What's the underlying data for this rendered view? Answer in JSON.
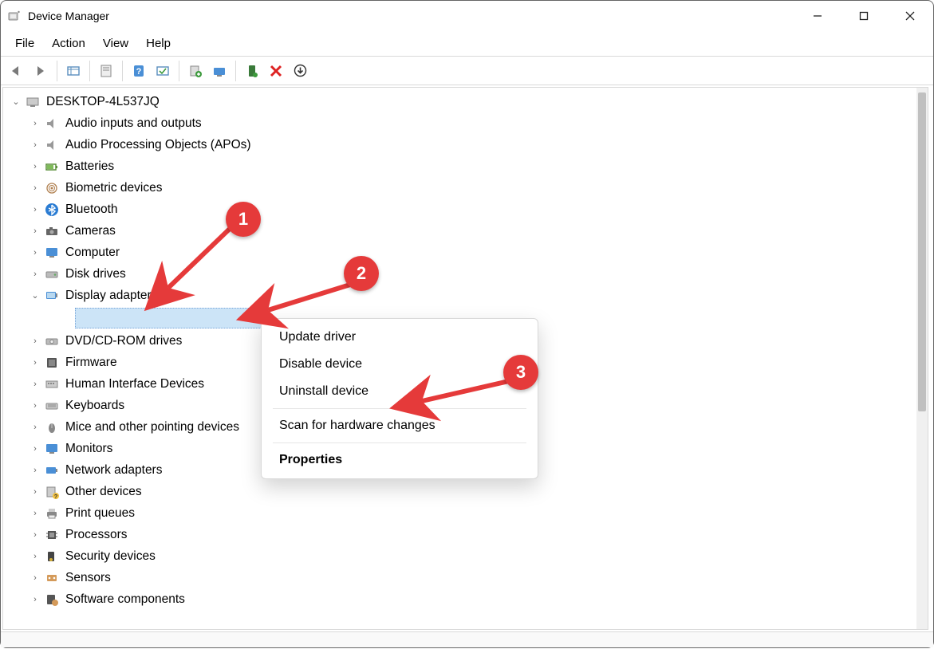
{
  "window": {
    "title": "Device Manager"
  },
  "menu": {
    "items": [
      "File",
      "Action",
      "View",
      "Help"
    ]
  },
  "tree": {
    "root": "DESKTOP-4L537JQ",
    "categories": [
      "Audio inputs and outputs",
      "Audio Processing Objects (APOs)",
      "Batteries",
      "Biometric devices",
      "Bluetooth",
      "Cameras",
      "Computer",
      "Disk drives",
      "Display adapters",
      "DVD/CD-ROM drives",
      "Firmware",
      "Human Interface Devices",
      "Keyboards",
      "Mice and other pointing devices",
      "Monitors",
      "Network adapters",
      "Other devices",
      "Print queues",
      "Processors",
      "Security devices",
      "Sensors",
      "Software components"
    ]
  },
  "context_menu": {
    "items": [
      "Update driver",
      "Disable device",
      "Uninstall device",
      "Scan for hardware changes",
      "Properties"
    ]
  },
  "annotations": {
    "m1": "1",
    "m2": "2",
    "m3": "3"
  }
}
